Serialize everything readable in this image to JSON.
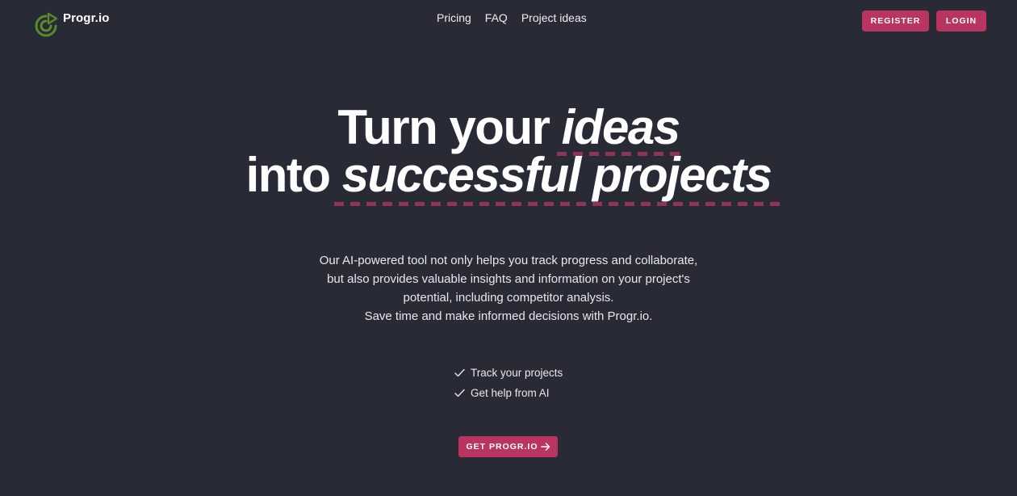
{
  "header": {
    "logo_text": "Progr.io",
    "nav": [
      {
        "label": "Pricing"
      },
      {
        "label": "FAQ"
      },
      {
        "label": "Project ideas"
      }
    ],
    "register_label": "REGISTER",
    "login_label": "LOGIN"
  },
  "hero": {
    "line1_plain": "Turn your ",
    "line1_em": "ideas",
    "line2_plain": "into ",
    "line2_em": "successful projects",
    "description": [
      "Our AI-powered tool not only helps you track progress and collaborate,",
      "but also provides valuable insights and information on your project's",
      "potential, including competitor analysis.",
      "Save time and make informed decisions with Progr.io."
    ],
    "features": [
      {
        "label": "Track your projects"
      },
      {
        "label": "Get help from AI"
      }
    ],
    "cta_label": "GET PROGR.IO"
  },
  "colors": {
    "background": "#282a36",
    "accent": "#b9345f",
    "underline": "#8f3358",
    "logo": "#5b8a2e"
  },
  "icons": {
    "logo": "progress-ring-play-icon",
    "feature": "checkmark-icon",
    "cta": "arrow-right-icon"
  }
}
